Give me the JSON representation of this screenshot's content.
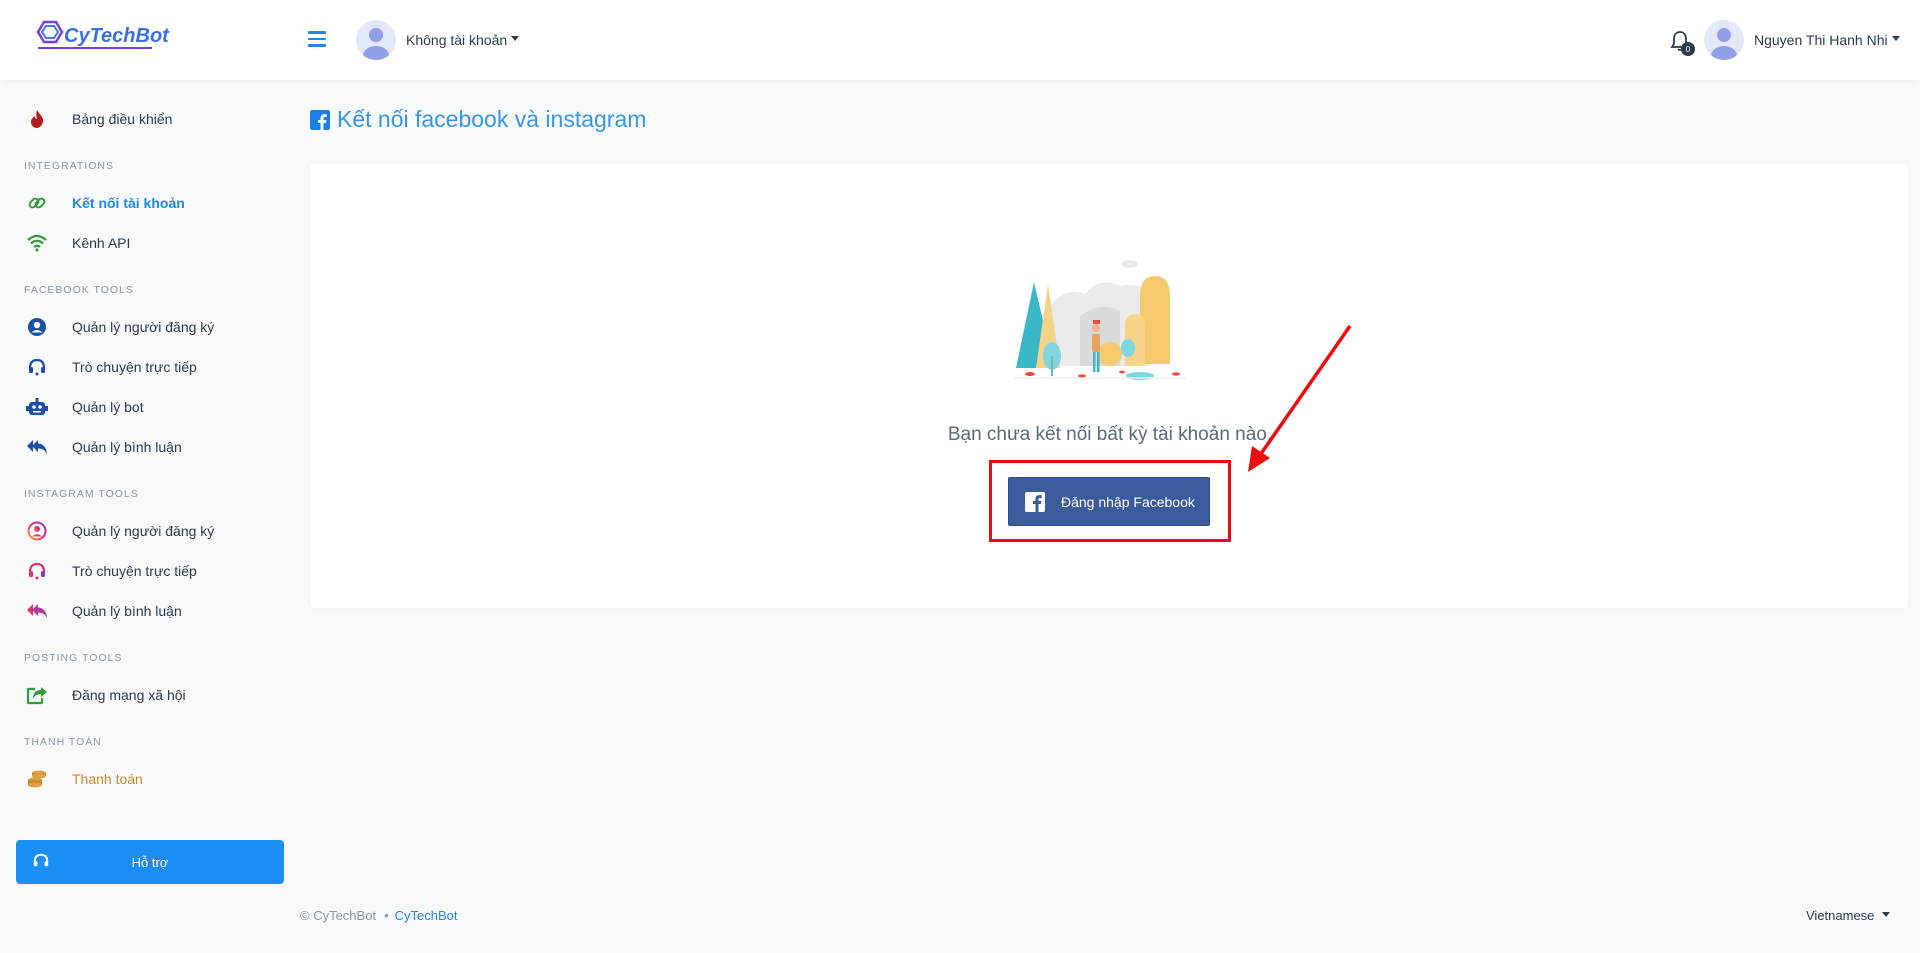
{
  "header": {
    "logo_text": "CyTechBot",
    "account_selector": "Không tài khoản",
    "notification_count": "0",
    "user_name": "Nguyen Thi Hanh Nhi"
  },
  "sidebar": {
    "dashboard": "Bảng điều khiển",
    "sections": {
      "integrations": "INTEGRATIONS",
      "facebook_tools": "FACEBOOK TOOLS",
      "instagram_tools": "INSTAGRAM TOOLS",
      "posting_tools": "POSTING TOOLS",
      "payment": "THANH TOÁN"
    },
    "items": {
      "connect_account": "Kết nối tài khoản",
      "api_channel": "Kênh API",
      "fb_subscribers": "Quản lý người đăng ký",
      "fb_livechat": "Trò chuyện trực tiếp",
      "fb_bot": "Quản lý bot",
      "fb_comments": "Quản lý bình luận",
      "ig_subscribers": "Quản lý người đăng ký",
      "ig_livechat": "Trò chuyện trực tiếp",
      "ig_comments": "Quản lý bình luận",
      "social_post": "Đăng mạng xã hội",
      "payment": "Thanh toán"
    },
    "support": "Hỗ trợ"
  },
  "main": {
    "title": "Kết nối facebook và instagram",
    "empty_message": "Bạn chưa kết nối bất kỳ tài khoản nào.",
    "login_button": "Đăng nhập Facebook"
  },
  "footer": {
    "copyright": "© CyTechBot",
    "separator": "•",
    "link": "CyTechBot",
    "language": "Vietnamese"
  },
  "colors": {
    "accent": "#1e88e5",
    "facebook": "#3b5b9d",
    "highlight": "#ee0b0b",
    "payment": "#c98a2e"
  }
}
